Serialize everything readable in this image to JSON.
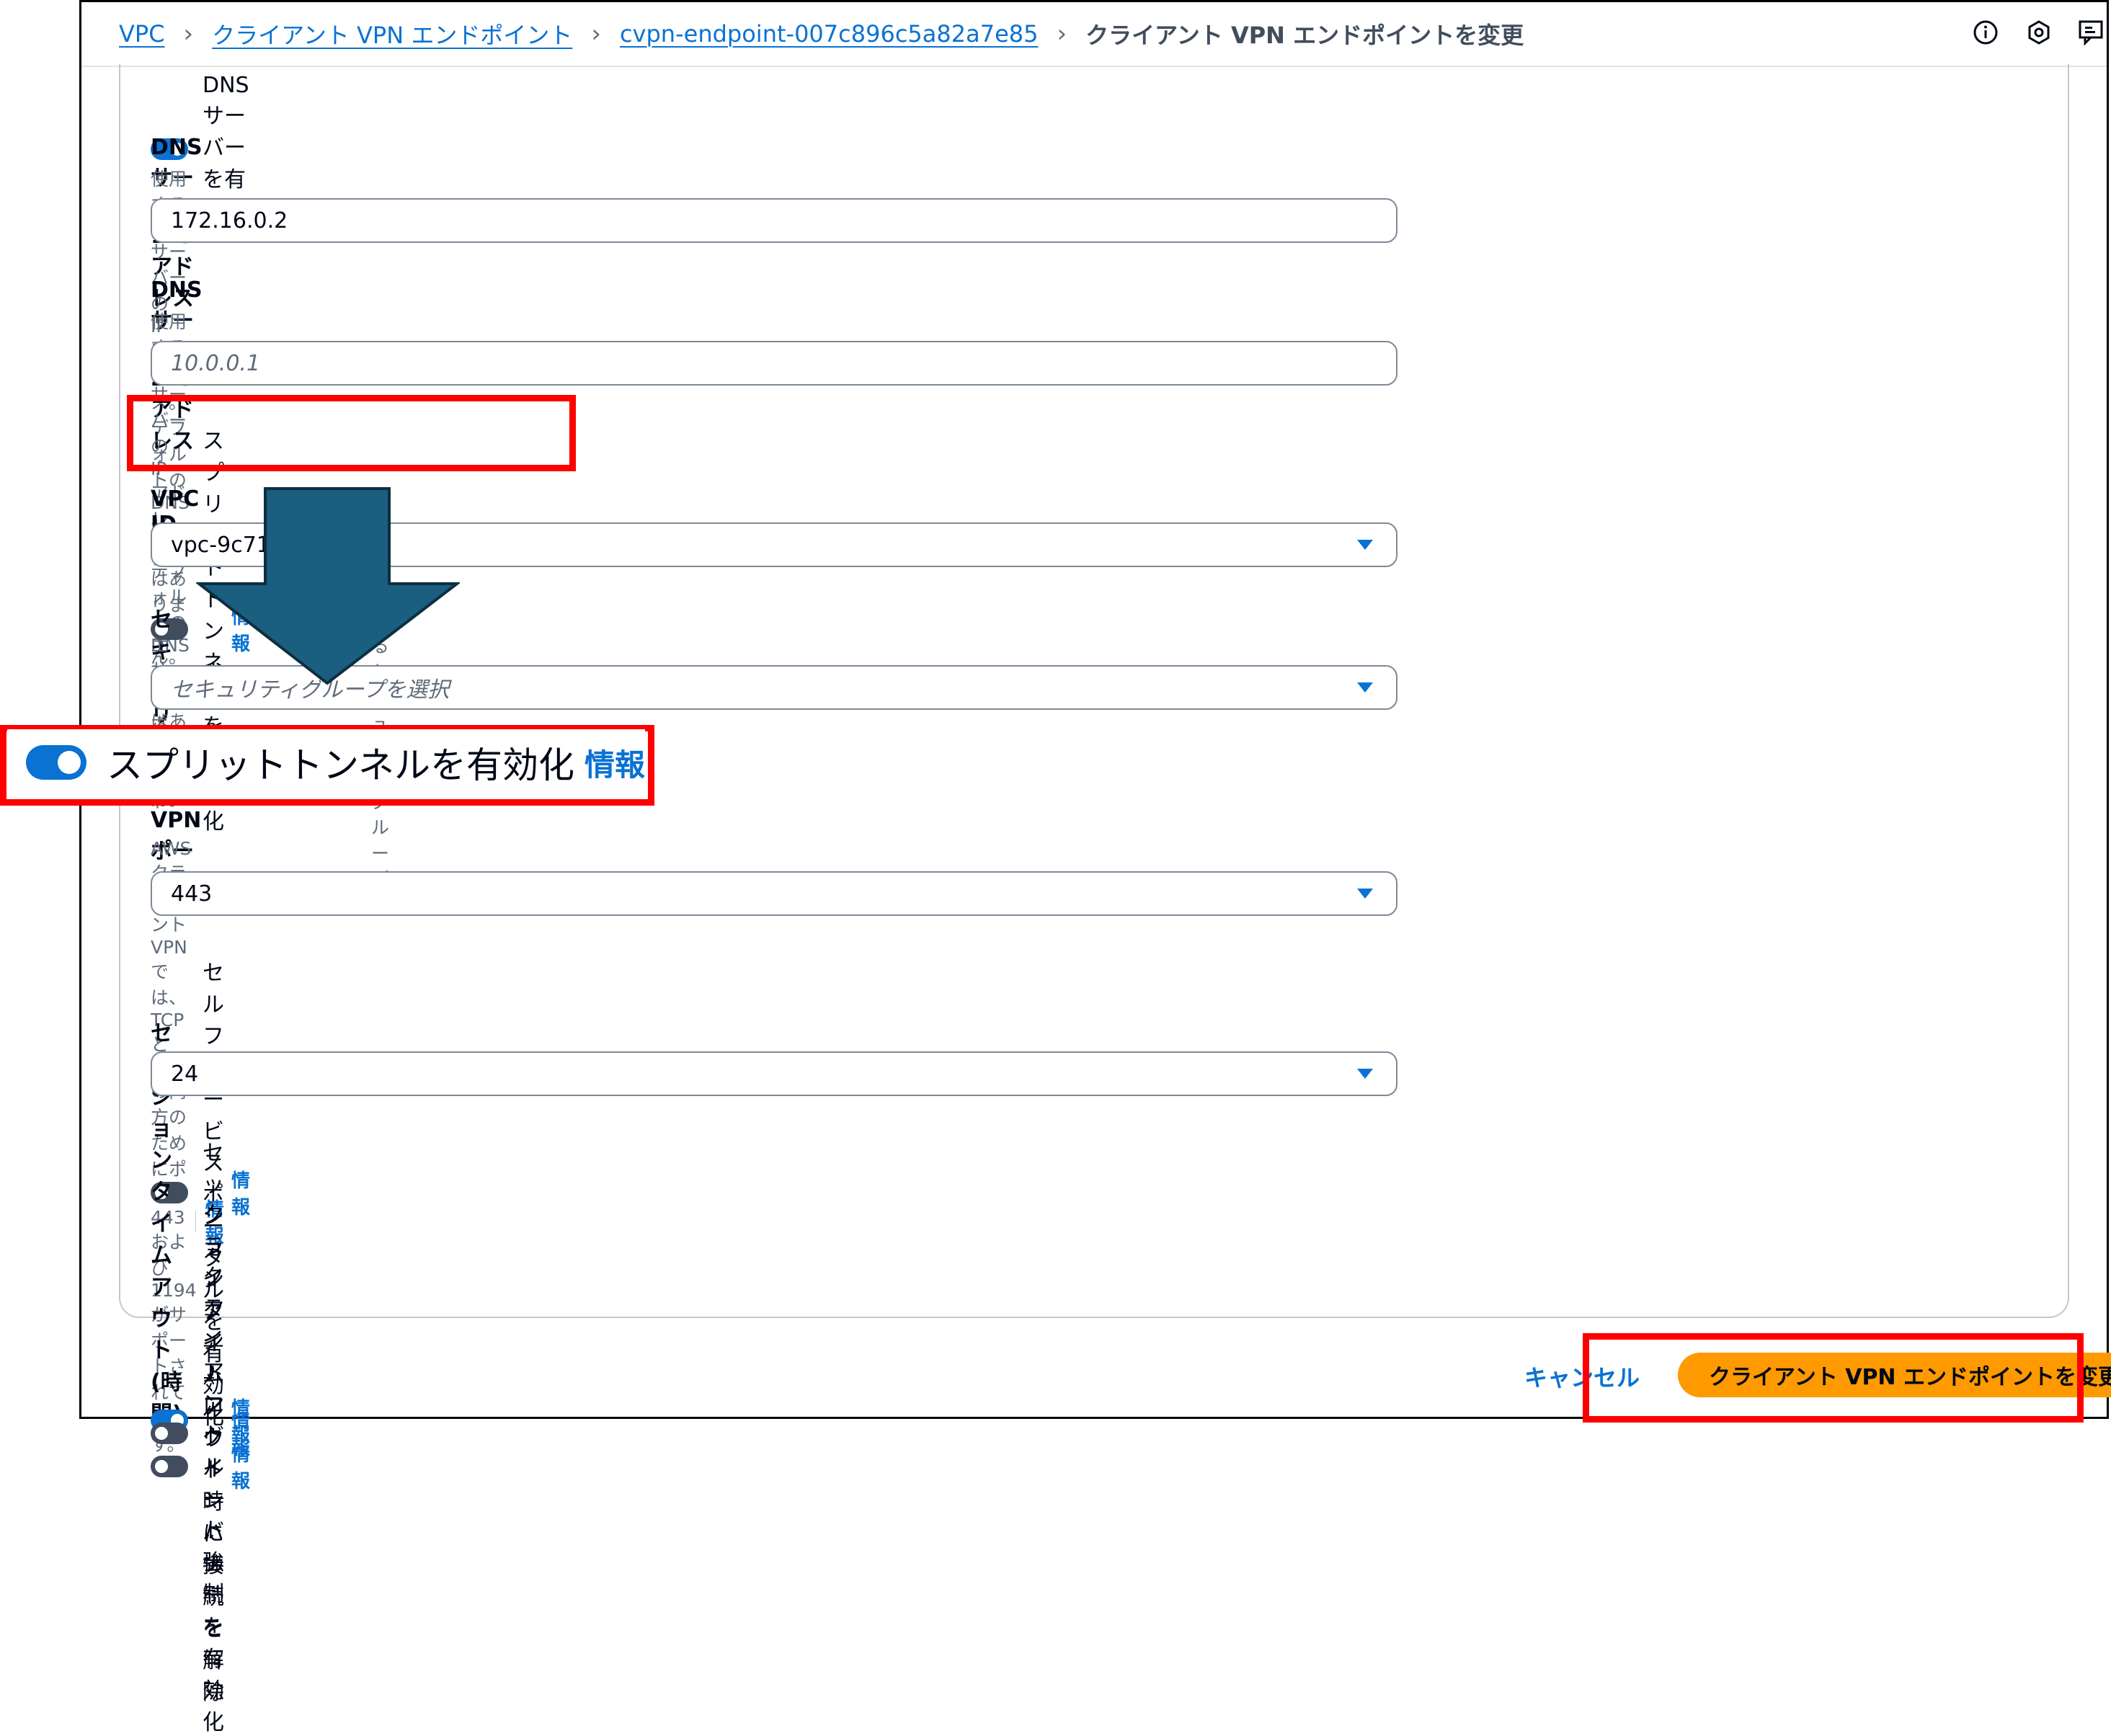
{
  "breadcrumb": {
    "items": [
      "VPC",
      "クライアント VPN エンドポイント",
      "cvpn-endpoint-007c896c5a82a7e85"
    ],
    "current": "クライアント VPN エンドポイントを変更"
  },
  "form": {
    "dns_enable": {
      "label": "DNS サーバーを有効化",
      "checked": true
    },
    "dns1": {
      "label": "DNS サーバー 1 IP アドレス",
      "desc": "使用する DNS サーバーの IP アドレス。デフォルトの DNS サーバーはありません。",
      "value": "172.16.0.2"
    },
    "dns2": {
      "label": "DNS サーバー 2 IP アドレス",
      "desc": "使用する DNS サーバーの IP アドレス。デフォルトの DNS サーバーはありません。",
      "placeholder": "10.0.0.1"
    },
    "split_tunnel": {
      "label": "スプリットトンネルを有効化",
      "info": "情報",
      "checked": false
    },
    "vpc_id": {
      "label": "VPC ID",
      "value": "vpc-9c71"
    },
    "security_groups": {
      "label": "セキュリ",
      "desc_prefix": "エンドポイント",
      "desc_suffix": "るセキュリティグループ。",
      "placeholder": "セキュリティグループを選択"
    },
    "split_tunnel_enabled_callout": {
      "label": "スプリットトンネルを有効化",
      "info": "情報",
      "checked": true
    },
    "vpn_port": {
      "label": "VPN ポート",
      "desc": "AWS クライアント VPN では、TCP と UDP の両方のためにポート 443 および 1194 がサポートされています。",
      "value": "443"
    },
    "self_service": {
      "label": "セルフサービスポータルを有効化",
      "info": "情報",
      "checked": false
    },
    "session_timeout": {
      "label": "セッションタイムアウト (時間)",
      "info": "情報",
      "value": "24"
    },
    "disconnect_on_timeout": {
      "label": "セッションタイムアウト時に接続を解除",
      "info": "情報",
      "checked": true
    },
    "login_banner": {
      "label": "クライアントログインバナーを有効化",
      "info": "情報",
      "checked": false
    },
    "route_enforcement": {
      "label": "クライアントルート強制",
      "info": "情報",
      "checked": false
    }
  },
  "footer": {
    "cancel": "キャンセル",
    "submit": "クライアント VPN エンドポイントを変更"
  },
  "colors": {
    "accent": "#0972d3",
    "primary": "#ff9900",
    "highlight": "#ff0000",
    "arrow": "#1a5e80"
  }
}
